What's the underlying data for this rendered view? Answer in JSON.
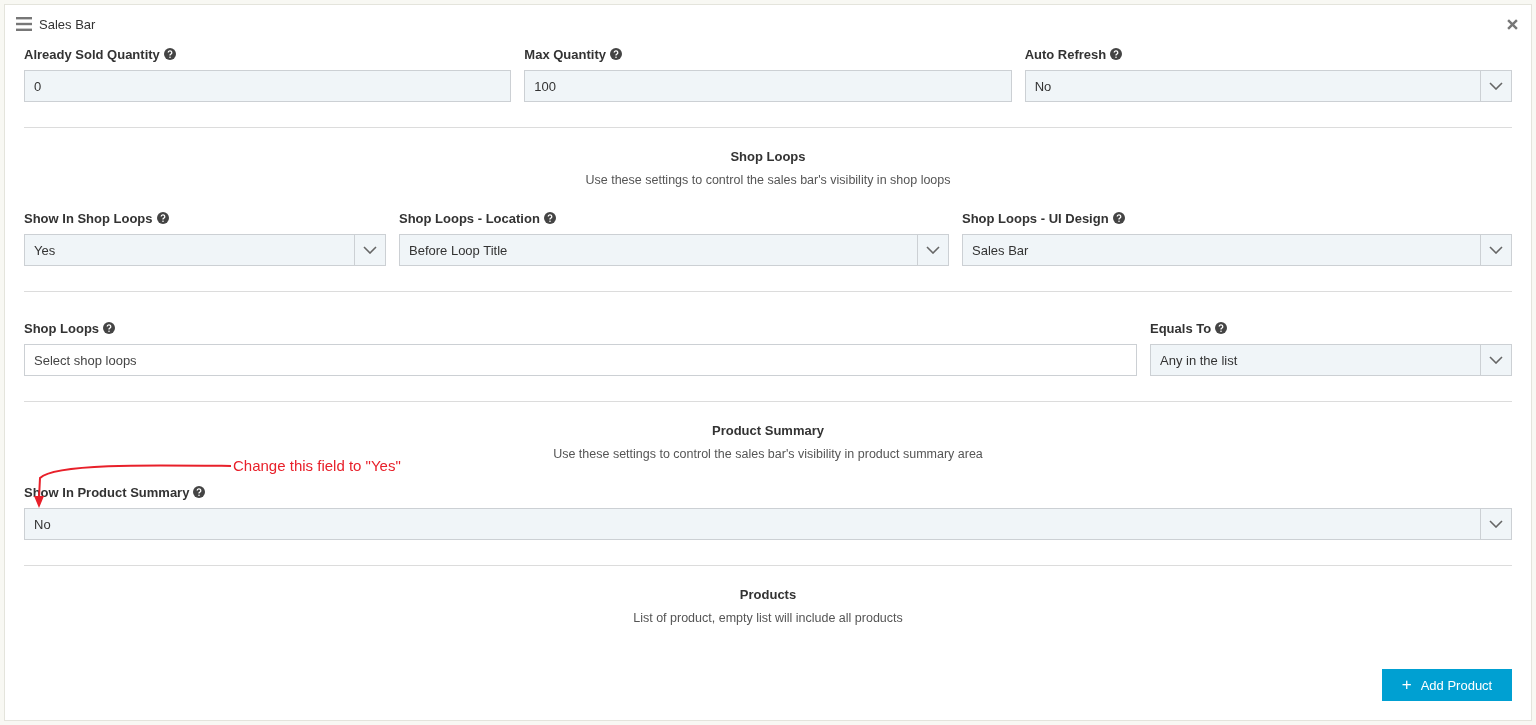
{
  "window": {
    "title": "Sales Bar"
  },
  "blocks": [
    {
      "kind": "fields",
      "fields": [
        {
          "label": "Already Sold Quantity",
          "kind": "text",
          "value": "0"
        },
        {
          "label": "Max Quantity",
          "kind": "text",
          "value": "100"
        },
        {
          "label": "Auto Refresh",
          "kind": "select",
          "value": "No"
        }
      ]
    },
    {
      "kind": "heading",
      "heading": "Shop Loops",
      "description": "Use these settings to control the sales bar's visibility in shop loops"
    },
    {
      "kind": "fields",
      "fields": [
        {
          "label": "Show In Shop Loops",
          "kind": "select",
          "value": "Yes"
        },
        {
          "label": "Shop Loops - Location",
          "kind": "select",
          "value": "Before Loop Title"
        },
        {
          "label": "Shop Loops - UI Design",
          "kind": "select",
          "value": "Sales Bar"
        }
      ]
    },
    {
      "kind": "fields",
      "fields": [
        {
          "label": "Shop Loops",
          "kind": "multiselect",
          "placeholder": "Select shop loops"
        },
        {
          "label": "Equals To",
          "kind": "select",
          "value": "Any in the list"
        }
      ]
    },
    {
      "kind": "heading",
      "heading": "Product Summary",
      "description": "Use these settings to control the sales bar's visibility in product summary area"
    },
    {
      "kind": "fields",
      "fields": [
        {
          "label": "Show In Product Summary",
          "kind": "select",
          "value": "No"
        }
      ]
    },
    {
      "kind": "heading",
      "heading": "Products",
      "description": "List of product, empty list will include all products"
    }
  ],
  "annotation": {
    "text": "Change this field to \"Yes\""
  },
  "add_button": {
    "icon": "+",
    "label": "Add Product"
  }
}
